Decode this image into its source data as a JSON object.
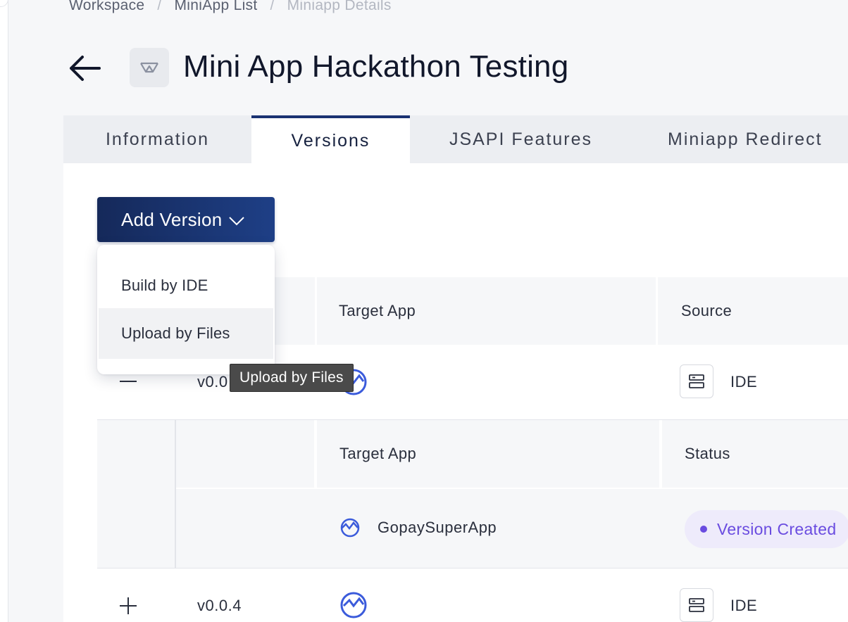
{
  "breadcrumb": {
    "items": [
      "Workspace",
      "MiniApp List"
    ],
    "current": "Miniapp Details",
    "separator": "/"
  },
  "header": {
    "title": "Mini App Hackathon Testing",
    "back_icon": "arrow-left-icon",
    "logo_icon": "miniapp-logo-icon"
  },
  "tabs": [
    {
      "label": "Information",
      "active": false
    },
    {
      "label": "Versions",
      "active": true
    },
    {
      "label": "JSAPI Features",
      "active": false
    },
    {
      "label": "Miniapp Redirect",
      "active": false
    }
  ],
  "toolbar": {
    "add_version_label": "Add Version"
  },
  "dropdown": {
    "items": [
      {
        "label": "Build by IDE"
      },
      {
        "label": "Upload by Files",
        "hovered": true
      }
    ]
  },
  "tooltip": {
    "text": "Upload by Files"
  },
  "table": {
    "headers": [
      "Target App",
      "Source"
    ],
    "rows": [
      {
        "expand": "collapse",
        "version": "v0.0",
        "target_icon": "gopay-app-icon",
        "source_icon": "server-icon",
        "source": "IDE"
      },
      {
        "expand": "expand",
        "version": "v0.0.4",
        "target_icon": "gopay-app-icon",
        "source_icon": "server-icon",
        "source": "IDE"
      }
    ]
  },
  "subtable": {
    "headers": [
      "Target App",
      "Status"
    ],
    "rows": [
      {
        "target_app": "GopaySuperApp",
        "status": "Version Created"
      }
    ]
  },
  "colors": {
    "primary": "#1a3272",
    "status_purple": "#6a4ce0",
    "status_bg": "#eeebfb",
    "app_blue": "#3b5bdb"
  }
}
